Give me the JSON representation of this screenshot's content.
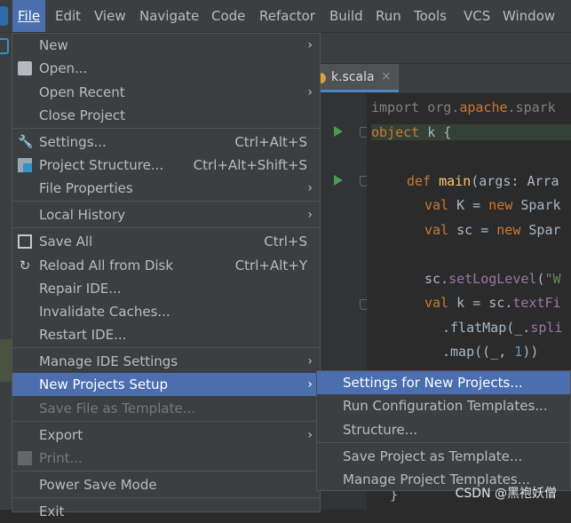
{
  "menubar": {
    "items": [
      {
        "label": "File",
        "active": true
      },
      {
        "label": "Edit"
      },
      {
        "label": "View"
      },
      {
        "label": "Navigate"
      },
      {
        "label": "Code"
      },
      {
        "label": "Refactor"
      },
      {
        "label": "Build"
      },
      {
        "label": "Run"
      },
      {
        "label": "Tools"
      },
      {
        "label": "VCS"
      },
      {
        "label": "Window"
      }
    ]
  },
  "editor": {
    "tab": {
      "name": "k.scala",
      "close": "×"
    },
    "lines": {
      "l1": {
        "kw": "import",
        "pk1": " org.",
        "apache": "apache",
        "pk2": ".spark"
      },
      "l2": {
        "kw": "object",
        "rest": " k {"
      },
      "l3": {
        "kw": "def ",
        "fn": "main",
        "rest": "(args: Arra"
      },
      "l4": {
        "kw": "val ",
        "rest": "K = ",
        "kw2": "new ",
        "rest2": "Spark"
      },
      "l5": {
        "kw": "val ",
        "rest": "sc = ",
        "kw2": "new ",
        "rest2": "Spar"
      },
      "l6": {
        "pre": "sc.",
        "field": "setLogLevel",
        "rest": "(",
        "str": "\"W"
      },
      "l7": {
        "kw": "val ",
        "rest": "k = sc.",
        "field": "textFi"
      },
      "l8": {
        "pre": ".flatMap(_.",
        "field": "spli"
      },
      "l9": {
        "pre": ".map((_, ",
        "num": "1",
        "rest": "))"
      },
      "tail": "}"
    }
  },
  "file_menu": {
    "items": [
      {
        "label": "New",
        "arrow": "›"
      },
      {
        "label": "Open...",
        "icon": "folder-icon"
      },
      {
        "label": "Open Recent",
        "arrow": "›"
      },
      {
        "label": "Close Project"
      },
      {
        "label": "Settings...",
        "shortcut": "Ctrl+Alt+S",
        "icon": "wrench-icon"
      },
      {
        "label": "Project Structure...",
        "shortcut": "Ctrl+Alt+Shift+S",
        "icon": "project-structure-icon"
      },
      {
        "label": "File Properties",
        "arrow": "›"
      },
      {
        "label": "Local History",
        "arrow": "›"
      },
      {
        "label": "Save All",
        "shortcut": "Ctrl+S",
        "icon": "save-icon"
      },
      {
        "label": "Reload All from Disk",
        "shortcut": "Ctrl+Alt+Y",
        "icon": "reload-icon"
      },
      {
        "label": "Repair IDE..."
      },
      {
        "label": "Invalidate Caches..."
      },
      {
        "label": "Restart IDE..."
      },
      {
        "label": "Manage IDE Settings",
        "arrow": "›"
      },
      {
        "label": "New Projects Setup",
        "arrow": "›",
        "active": true
      },
      {
        "label": "Save File as Template...",
        "disabled": true
      },
      {
        "label": "Export",
        "arrow": "›"
      },
      {
        "label": "Print...",
        "disabled": true,
        "icon": "print-icon"
      },
      {
        "label": "Power Save Mode"
      },
      {
        "label": "Exit"
      }
    ]
  },
  "submenu": {
    "items": [
      {
        "label": "Settings for New Projects...",
        "active": true
      },
      {
        "label": "Run Configuration Templates..."
      },
      {
        "label": "Structure..."
      },
      {
        "label": "Save Project as Template..."
      },
      {
        "label": "Manage Project Templates..."
      }
    ]
  },
  "watermark": "CSDN @黑袍妖僧"
}
